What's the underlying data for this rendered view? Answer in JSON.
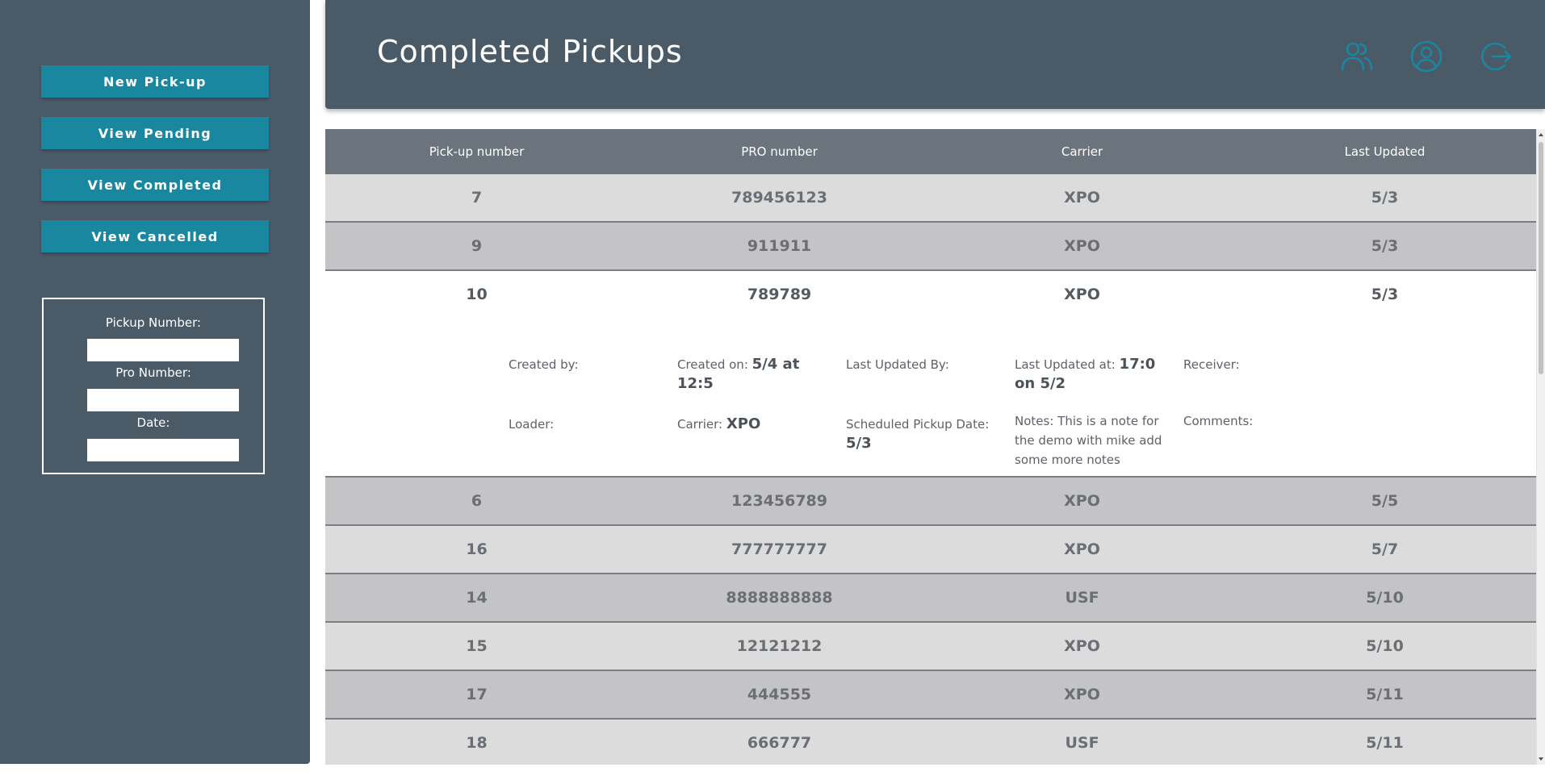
{
  "sidebar": {
    "buttons": [
      "New Pick-up",
      "View Pending",
      "View Completed",
      "View Cancelled"
    ],
    "search": {
      "pickup_label": "Pickup Number:",
      "pickup_value": "",
      "pro_label": "Pro Number:",
      "pro_value": "",
      "date_label": "Date:",
      "date_value": ""
    }
  },
  "header": {
    "title": "Completed Pickups",
    "icons": [
      "users-icon",
      "account-icon",
      "logout-icon"
    ]
  },
  "table": {
    "columns": [
      "Pick-up number",
      "PRO number",
      "Carrier",
      "Last Updated"
    ],
    "rows": [
      {
        "pickup": "7",
        "pro": "789456123",
        "carrier": "XPO",
        "updated": "5/3"
      },
      {
        "pickup": "9",
        "pro": "911911",
        "carrier": "XPO",
        "updated": "5/3"
      },
      {
        "pickup": "10",
        "pro": "789789",
        "carrier": "XPO",
        "updated": "5/3"
      },
      {
        "pickup": "6",
        "pro": "123456789",
        "carrier": "XPO",
        "updated": "5/5"
      },
      {
        "pickup": "16",
        "pro": "777777777",
        "carrier": "XPO",
        "updated": "5/7"
      },
      {
        "pickup": "14",
        "pro": "8888888888",
        "carrier": "USF",
        "updated": "5/10"
      },
      {
        "pickup": "15",
        "pro": "12121212",
        "carrier": "XPO",
        "updated": "5/10"
      },
      {
        "pickup": "17",
        "pro": "444555",
        "carrier": "XPO",
        "updated": "5/11"
      },
      {
        "pickup": "18",
        "pro": "666777",
        "carrier": "USF",
        "updated": "5/11"
      }
    ],
    "expanded_detail": {
      "created_by_label": "Created by:",
      "created_by_value": "",
      "created_on_label": "Created on:",
      "created_on_value": "5/4 at 12:5",
      "last_updated_by_label": "Last Updated By:",
      "last_updated_by_value": "",
      "last_updated_at_label": "Last Updated at:",
      "last_updated_at_value": "17:0 on 5/2",
      "receiver_label": "Receiver:",
      "receiver_value": "",
      "loader_label": "Loader:",
      "loader_value": "",
      "carrier_label": "Carrier:",
      "carrier_value": "XPO",
      "scheduled_label": "Scheduled Pickup Date:",
      "scheduled_value": "5/3",
      "notes_label": "Notes:",
      "notes_value": "This is a note for the demo with mike add some more notes",
      "comments_label": "Comments:",
      "comments_value": ""
    }
  },
  "colors": {
    "sidebar_bg": "#4b5a67",
    "button_bg": "#1a87a0",
    "accent_icon": "#1a87a0",
    "table_header_bg": "#6b737c",
    "row_light": "#dcdcdc",
    "row_dark": "#c4c3c6"
  }
}
